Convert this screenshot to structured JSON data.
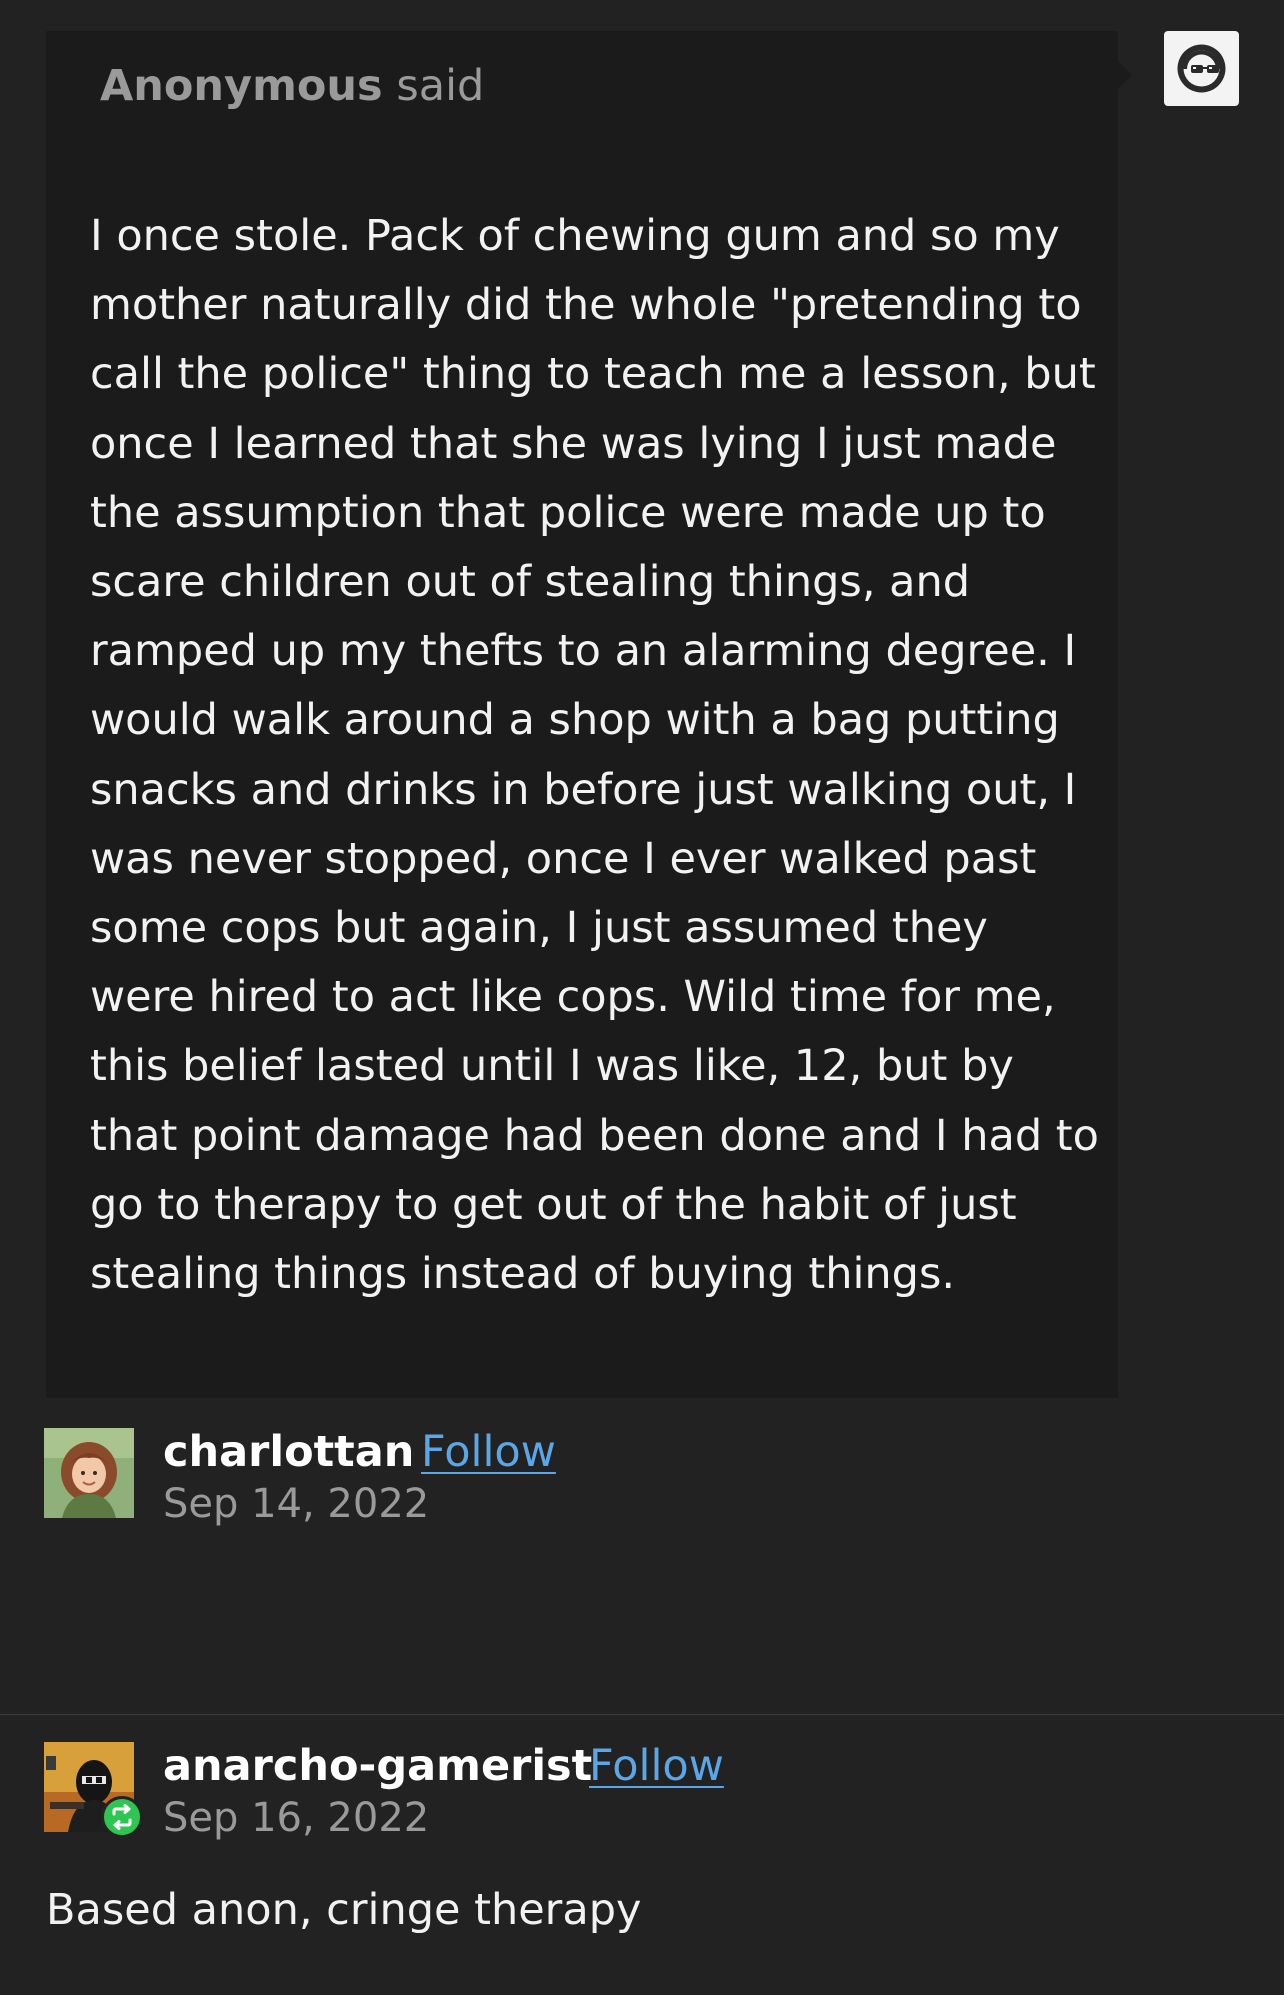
{
  "colors": {
    "background": "#222222",
    "ask_box": "#1b1b1b",
    "link": "#5aa6e6",
    "muted_text": "#9a9a9a",
    "reblog_badge": "#2ec553"
  },
  "ask": {
    "asker_name": "Anonymous",
    "asker_verb": "said",
    "avatar_icon": "sunglasses-face-icon",
    "question": "I once stole. Pack of chewing gum and so my mother naturally did the whole \"pretending to call the police\" thing to teach me a lesson, but once I learned that she was lying I just made the assumption that police were made up to scare children out of stealing things, and ramped up my thefts to an alarming degree. I would walk around a shop with a bag putting snacks and drinks in before just walking out, I was never stopped, once I ever walked past some cops but again, I just assumed they were hired to act like cops. Wild time for me, this belief lasted until I was like, 12, but by that point damage had been done and I had to go to therapy to get out of the habit of just stealing things instead of buying things."
  },
  "posts": [
    {
      "username": "charlottan",
      "follow_label": "Follow",
      "date": "Sep 14, 2022"
    },
    {
      "username": "anarcho-gamerist",
      "follow_label": "Follow",
      "date": "Sep 16, 2022",
      "badge_icon": "reblog-icon",
      "reply": "Based anon, cringe therapy"
    }
  ]
}
